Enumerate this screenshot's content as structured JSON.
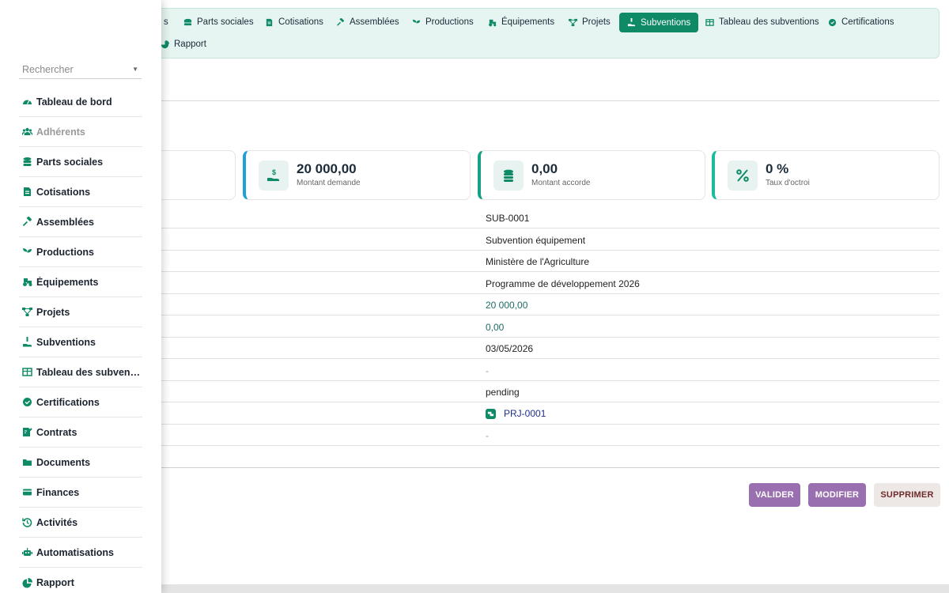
{
  "tabs": [
    {
      "label": "s",
      "icon": "users-icon"
    },
    {
      "label": "Parts sociales",
      "icon": "coins-icon"
    },
    {
      "label": "Cotisations",
      "icon": "receipt-icon"
    },
    {
      "label": "Assemblées",
      "icon": "gavel-icon"
    },
    {
      "label": "Productions",
      "icon": "seedling-icon"
    },
    {
      "label": "Équipements",
      "icon": "tractor-icon"
    },
    {
      "label": "Projets",
      "icon": "project-diagram-icon"
    },
    {
      "label": "Subventions",
      "icon": "hand-money-icon",
      "active": true
    },
    {
      "label": "Tableau des subventions",
      "icon": "table-icon"
    },
    {
      "label": "Certifications",
      "icon": "certificate-icon"
    },
    {
      "label": "Rapport",
      "icon": "pie-chart-icon"
    }
  ],
  "stats": [
    {
      "value": "20 000,00",
      "label": "Montant demande",
      "icon": "hand-dollar-icon"
    },
    {
      "value": "0,00",
      "label": "Montant accorde",
      "icon": "coins-icon"
    },
    {
      "value": "0 %",
      "label": "Taux d'octroi",
      "icon": "percent-icon"
    }
  ],
  "details": [
    {
      "value": "SUB-0001"
    },
    {
      "value": "Subvention équipement"
    },
    {
      "value": "Ministère de l'Agriculture"
    },
    {
      "value": "Programme de développement 2026"
    },
    {
      "value": "20 000,00",
      "kind": "num"
    },
    {
      "value": "0,00",
      "kind": "num"
    },
    {
      "value": "03/05/2026"
    },
    {
      "value": "-",
      "kind": "dash"
    },
    {
      "value": "pending"
    },
    {
      "value": "PRJ-0001",
      "kind": "link"
    },
    {
      "value": "-",
      "kind": "dash"
    },
    {
      "value": ""
    }
  ],
  "actions": {
    "validate": "VALIDER",
    "edit": "MODIFIER",
    "delete": "SUPPRIMER"
  },
  "sidebar": {
    "search_placeholder": "Rechercher",
    "items": [
      {
        "label": "Tableau de bord",
        "icon": "dashboard-icon"
      },
      {
        "label": "Adhérents",
        "icon": "users-icon",
        "muted": true
      },
      {
        "label": "Parts sociales",
        "icon": "coins-icon"
      },
      {
        "label": "Cotisations",
        "icon": "receipt-icon"
      },
      {
        "label": "Assemblées",
        "icon": "gavel-icon"
      },
      {
        "label": "Productions",
        "icon": "seedling-icon"
      },
      {
        "label": "Équipements",
        "icon": "tractor-icon"
      },
      {
        "label": "Projets",
        "icon": "project-diagram-icon"
      },
      {
        "label": "Subventions",
        "icon": "hand-money-icon"
      },
      {
        "label": "Tableau des subventions",
        "icon": "table-icon"
      },
      {
        "label": "Certifications",
        "icon": "certificate-icon"
      },
      {
        "label": "Contrats",
        "icon": "contract-icon"
      },
      {
        "label": "Documents",
        "icon": "folder-icon"
      },
      {
        "label": "Finances",
        "icon": "wallet-icon"
      },
      {
        "label": "Activités",
        "icon": "history-icon"
      },
      {
        "label": "Automatisations",
        "icon": "robot-icon"
      },
      {
        "label": "Rapport",
        "icon": "pie-chart-icon"
      }
    ]
  },
  "colors": {
    "accent": "#0e8a67",
    "tab_bg": "#e6f5f1",
    "button_purple": "#9a6fb0",
    "card_blue": "#1fa0d8",
    "card_green": "#16a085",
    "card_teal": "#1abc9c"
  }
}
